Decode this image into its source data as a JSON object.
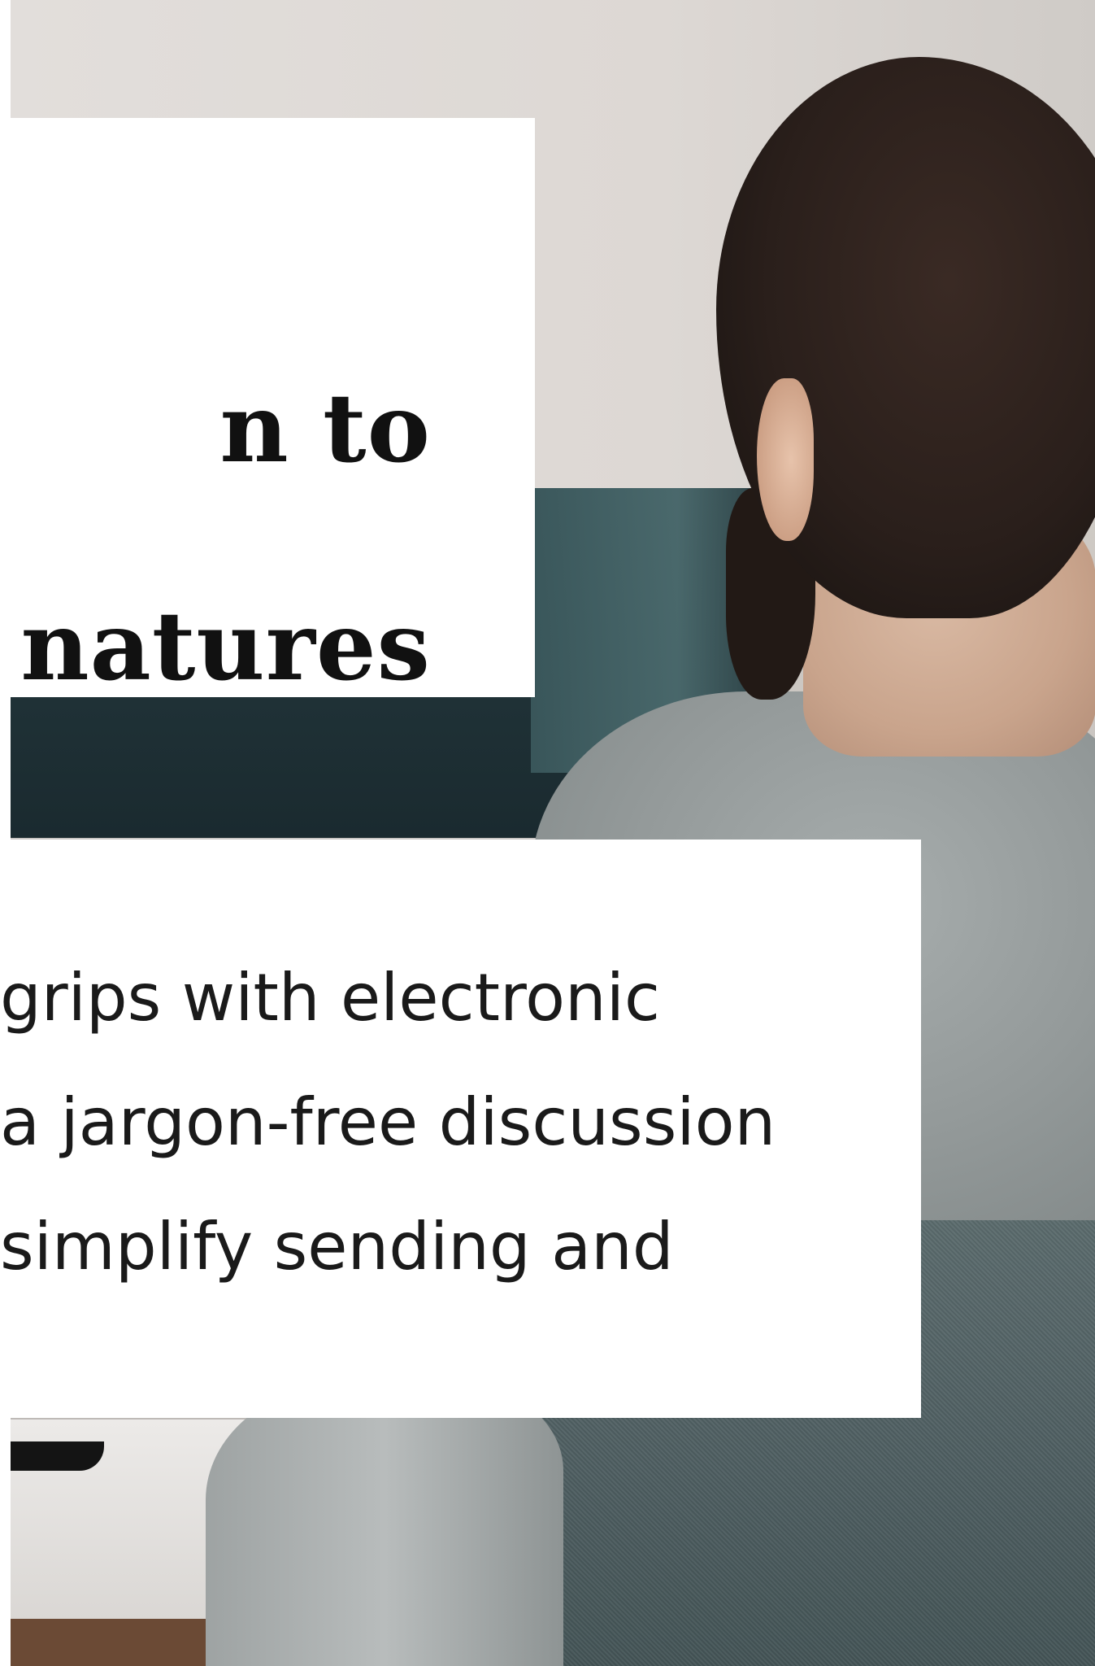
{
  "hero": {
    "title_lines": [
      "n to",
      "natures"
    ],
    "body_lines": [
      "grips with electronic",
      "a jargon-free discussion",
      "simplify sending and"
    ]
  },
  "colors": {
    "card_background": "#ffffff",
    "title_text": "#111111",
    "body_text": "#1a1a1a"
  }
}
